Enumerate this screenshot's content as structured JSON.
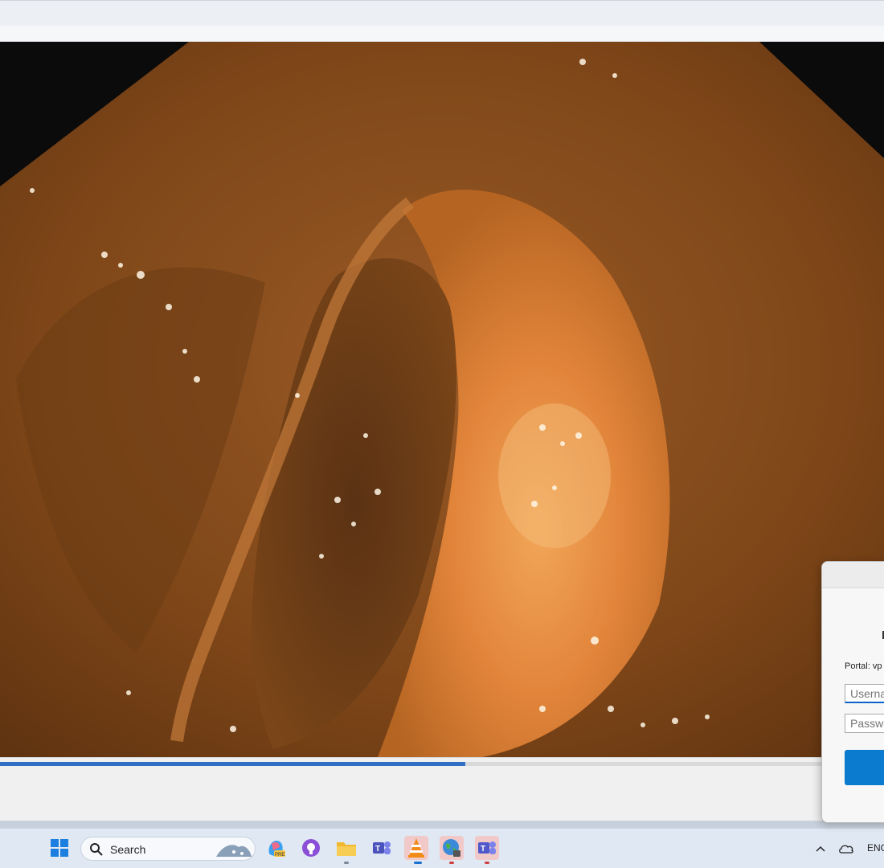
{
  "window": {
    "title": ""
  },
  "player": {
    "progress_fraction": 0.526
  },
  "login_dialog": {
    "portal_label": "Portal: vp",
    "username_placeholder": "Userna",
    "password_placeholder": "Passwo"
  },
  "taskbar": {
    "search_placeholder": "Search",
    "apps": [
      "windows-start-icon",
      "copilot-icon",
      "github-icon",
      "file-explorer-icon",
      "teams-icon",
      "vlc-icon",
      "vpn-globe-icon",
      "teams-work-icon"
    ],
    "tray": {
      "language": "ENG"
    }
  },
  "colors": {
    "accent": "#0a7bcf",
    "progress": "#2f6fc4"
  }
}
